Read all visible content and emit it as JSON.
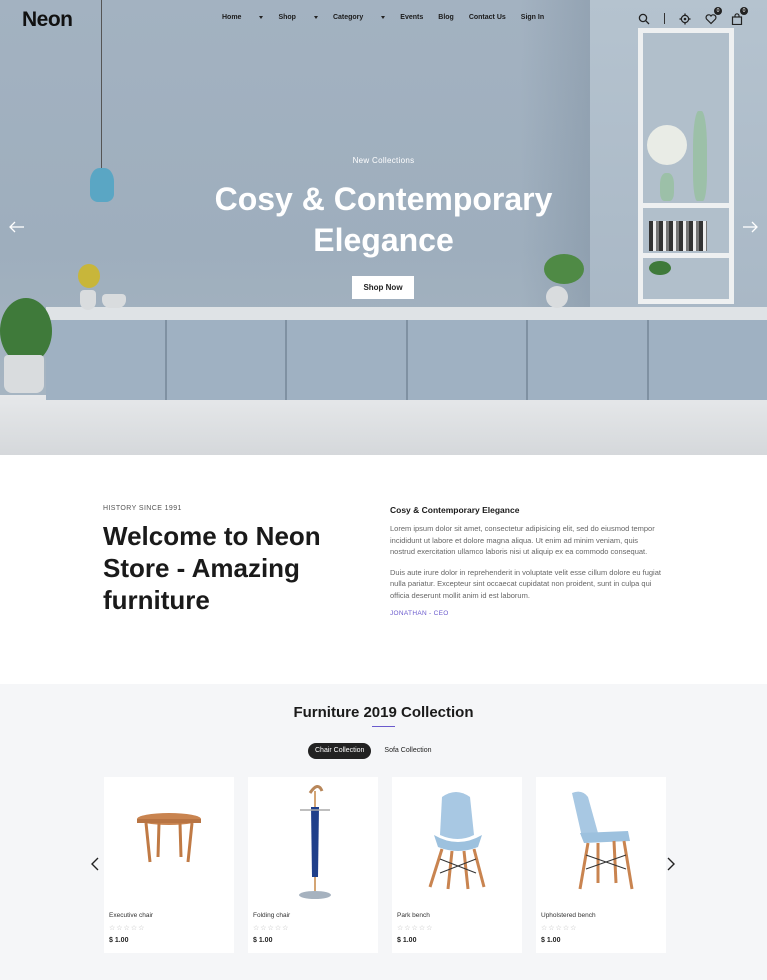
{
  "brand": {
    "logo": "Neon"
  },
  "nav": {
    "items": [
      {
        "label": "Home",
        "dropdown": true
      },
      {
        "label": "Shop",
        "dropdown": true
      },
      {
        "label": "Category",
        "dropdown": true
      },
      {
        "label": "Events",
        "dropdown": false
      },
      {
        "label": "Blog",
        "dropdown": false
      },
      {
        "label": "Contact Us",
        "dropdown": false
      },
      {
        "label": "Sign In",
        "dropdown": false
      }
    ],
    "icons": {
      "search": "search-icon",
      "settings": "gear-icon",
      "wishlist": "heart-icon",
      "cart": "shopping-bag-icon"
    },
    "wishlist_count": "0",
    "cart_count": "0"
  },
  "hero": {
    "subtitle": "New Collections",
    "title_line1": "Cosy & Contemporary",
    "title_line2": "Elegance",
    "button": "Shop Now"
  },
  "about": {
    "kicker": "HISTORY SINCE 1991",
    "title": "Welcome to Neon Store - Amazing furniture",
    "heading": "Cosy & Contemporary Elegance",
    "para1": "Lorem ipsum dolor sit amet, consectetur adipisicing elit, sed do eiusmod tempor incididunt ut labore et dolore magna aliqua. Ut enim ad minim veniam, quis nostrud exercitation ullamco laboris nisi ut aliquip ex ea commodo consequat.",
    "para2": "Duis aute irure dolor in reprehenderit in voluptate velit esse cillum dolore eu fugiat nulla pariatur. Excepteur sint occaecat cupidatat non proident, sunt in culpa qui officia deserunt mollit anim id est laborum.",
    "signature": "JONATHAN - CEO"
  },
  "collection": {
    "title": "Furniture 2019 Collection",
    "tabs": [
      "Chair Collection",
      "Sofa Collection"
    ],
    "active_tab": "Chair Collection",
    "products": [
      {
        "name": "Executive chair",
        "price": "$ 1.00",
        "stars": "☆☆☆☆☆"
      },
      {
        "name": "Folding chair",
        "price": "$ 1.00",
        "stars": "☆☆☆☆☆"
      },
      {
        "name": "Park bench",
        "price": "$ 1.00",
        "stars": "☆☆☆☆☆"
      },
      {
        "name": "Upholstered bench",
        "price": "$ 1.00",
        "stars": "☆☆☆☆☆"
      }
    ]
  },
  "colors": {
    "accent": "#6a5acd",
    "hero_wall": "#a3b2c1",
    "dark": "#222222"
  }
}
